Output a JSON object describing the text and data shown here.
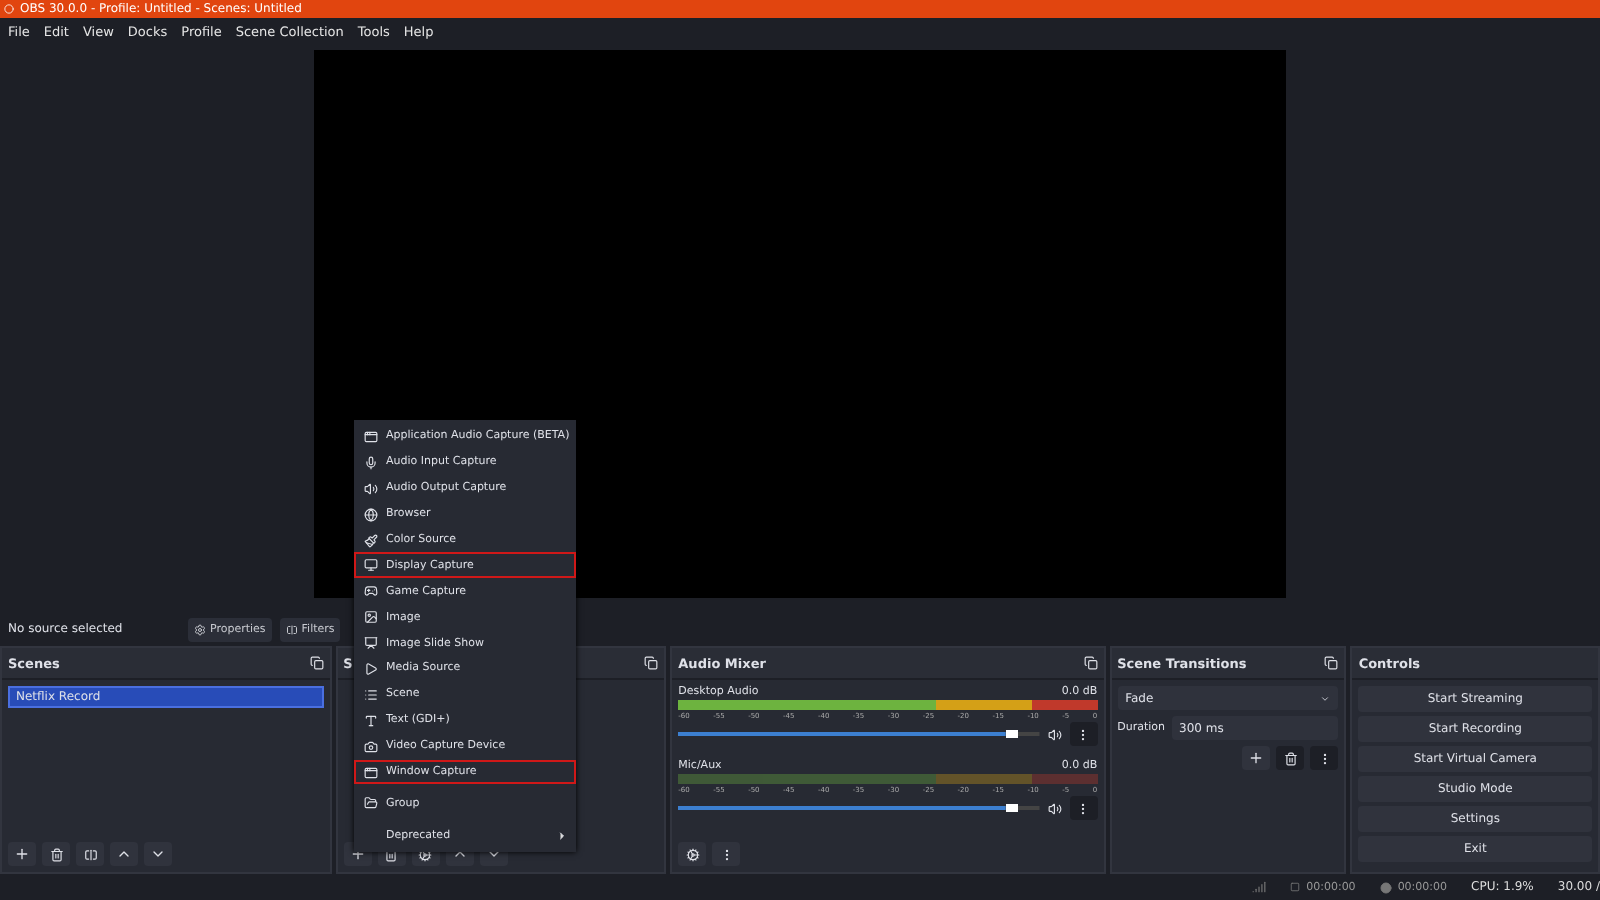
{
  "window": {
    "title": "OBS 30.0.0 - Profile: Untitled - Scenes: Untitled"
  },
  "menu_bar": [
    "File",
    "Edit",
    "View",
    "Docks",
    "Profile",
    "Scene Collection",
    "Tools",
    "Help"
  ],
  "source_bar": {
    "status": "No source selected",
    "buttons": [
      "Properties",
      "Filters"
    ]
  },
  "scenes": {
    "title": "Scenes",
    "items": [
      {
        "label": "Netflix Record",
        "selected": true
      }
    ]
  },
  "sources": {
    "title": "S"
  },
  "add_source_menu": {
    "items": [
      {
        "label": "Application Audio Capture (BETA)",
        "kind": "item",
        "highlighted": false
      },
      {
        "label": "Audio Input Capture",
        "kind": "item",
        "highlighted": false
      },
      {
        "label": "Audio Output Capture",
        "kind": "item",
        "highlighted": false
      },
      {
        "label": "Browser",
        "kind": "item",
        "highlighted": false
      },
      {
        "label": "Color Source",
        "kind": "item",
        "highlighted": false
      },
      {
        "label": "Display Capture",
        "kind": "item",
        "highlighted": true
      },
      {
        "label": "Game Capture",
        "kind": "item",
        "highlighted": false
      },
      {
        "label": "Image",
        "kind": "item",
        "highlighted": false
      },
      {
        "label": "Image Slide Show",
        "kind": "item",
        "highlighted": false
      },
      {
        "label": "Media Source",
        "kind": "item",
        "highlighted": false
      },
      {
        "label": "Scene",
        "kind": "item",
        "highlighted": false
      },
      {
        "label": "Text (GDI+)",
        "kind": "item",
        "highlighted": false
      },
      {
        "label": "Video Capture Device",
        "kind": "item",
        "highlighted": false
      },
      {
        "label": "Window Capture",
        "kind": "item",
        "highlighted": true
      },
      {
        "label": "Group",
        "kind": "item",
        "highlighted": false
      },
      {
        "label": "Deprecated",
        "kind": "submenu",
        "highlighted": false
      }
    ]
  },
  "audio_mixer": {
    "title": "Audio Mixer",
    "channels": [
      {
        "name": "Desktop Audio",
        "reading": "0.0 dB",
        "level": 0.94,
        "active": true,
        "ticks": [
          "-60",
          "-55",
          "-50",
          "-45",
          "-40",
          "-35",
          "-30",
          "-25",
          "-20",
          "-15",
          "-10",
          "-5",
          "0"
        ]
      },
      {
        "name": "Mic/Aux",
        "reading": "0.0 dB",
        "level": 0.94,
        "active": false,
        "ticks": [
          "-60",
          "-55",
          "-50",
          "-45",
          "-40",
          "-35",
          "-30",
          "-25",
          "-20",
          "-15",
          "-10",
          "-5",
          "0"
        ]
      }
    ]
  },
  "scene_transitions": {
    "title": "Scene Transitions",
    "transition": "Fade",
    "duration_label": "Duration",
    "duration": "300 ms"
  },
  "controls": {
    "title": "Controls",
    "buttons": [
      "Start Streaming",
      "Start Recording",
      "Start Virtual Camera",
      "Studio Mode",
      "Settings",
      "Exit"
    ]
  },
  "status_bar": {
    "stream_time": "00:00:00",
    "record_time": "00:00:00",
    "cpu": "CPU: 1.9%",
    "fps": "30.00 /"
  }
}
